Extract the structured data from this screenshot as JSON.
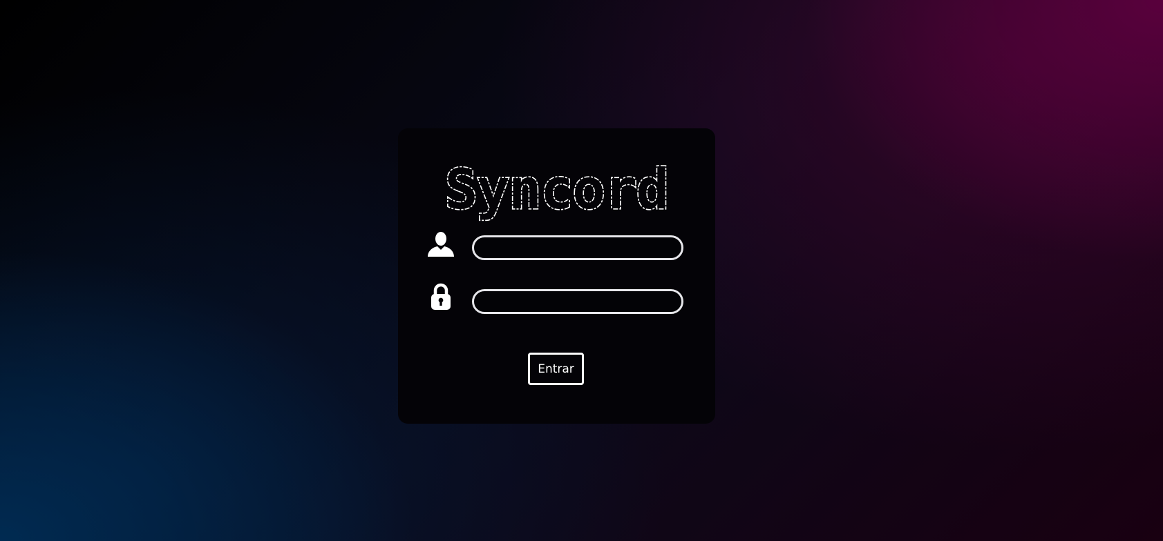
{
  "login": {
    "logo_text": "Syncord",
    "username": {
      "value": "",
      "placeholder": "",
      "icon": "user-icon"
    },
    "password": {
      "value": "",
      "placeholder": "",
      "icon": "lock-icon"
    },
    "submit_label": "Entrar"
  },
  "colors": {
    "card_background": "#040307",
    "accent": "#ffffff",
    "field_border": "#e6e6ea",
    "background_magenta": "#5c003e",
    "background_blue": "#002c54"
  }
}
